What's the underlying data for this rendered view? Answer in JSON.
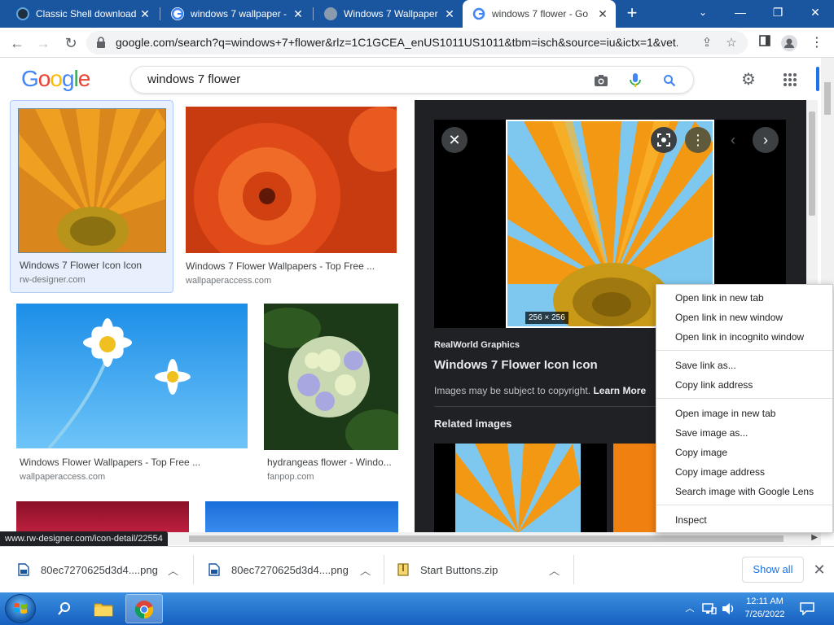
{
  "tabs": [
    {
      "title": "Classic Shell download",
      "active": false
    },
    {
      "title": "windows 7 wallpaper -",
      "active": false
    },
    {
      "title": "Windows 7 Wallpaper",
      "active": false
    },
    {
      "title": "windows 7 flower - Go",
      "active": true
    }
  ],
  "toolbar": {
    "url": "google.com/search?q=windows+7+flower&rlz=1C1GCEA_enUS1011US1011&tbm=isch&source=iu&ictx=1&vet..."
  },
  "google": {
    "logo_letters": [
      "G",
      "o",
      "o",
      "g",
      "l",
      "e"
    ],
    "logo_colors": [
      "#4285f4",
      "#ea4335",
      "#fbbc05",
      "#4285f4",
      "#34a853",
      "#ea4335"
    ],
    "query": "windows 7 flower"
  },
  "results": [
    {
      "caption": "Windows 7 Flower Icon Icon",
      "source": "rw-designer.com",
      "selected": true
    },
    {
      "caption": "Windows 7 Flower Wallpapers - Top Free ...",
      "source": "wallpaperaccess.com"
    },
    {
      "caption": "Windows Flower Wallpapers - Top Free ...",
      "source": "wallpaperaccess.com"
    },
    {
      "caption": "hydrangeas flower - Windo...",
      "source": "fanpop.com"
    }
  ],
  "preview": {
    "dimensions": "256 × 256",
    "site": "RealWorld Graphics",
    "title": "Windows 7 Flower Icon Icon",
    "copyright": "Images may be subject to copyright.",
    "learn_more": "Learn More",
    "related": "Related images"
  },
  "status_url": "www.rw-designer.com/icon-detail/22554",
  "context_menu": {
    "groups": [
      [
        "Open link in new tab",
        "Open link in new window",
        "Open link in incognito window"
      ],
      [
        "Save link as...",
        "Copy link address"
      ],
      [
        "Open image in new tab",
        "Save image as...",
        "Copy image",
        "Copy image address",
        "Search image with Google Lens"
      ],
      [
        "Inspect"
      ]
    ]
  },
  "downloads": {
    "items": [
      "80ec7270625d3d4....png",
      "80ec7270625d3d4....png",
      "Start Buttons.zip"
    ],
    "show_all": "Show all"
  },
  "taskbar": {
    "time": "12:11 AM",
    "date": "7/26/2022"
  },
  "colors": {
    "tab_strip": "#1a55a0",
    "accent_blue": "#1a73e8",
    "preview_bg": "#202124"
  }
}
